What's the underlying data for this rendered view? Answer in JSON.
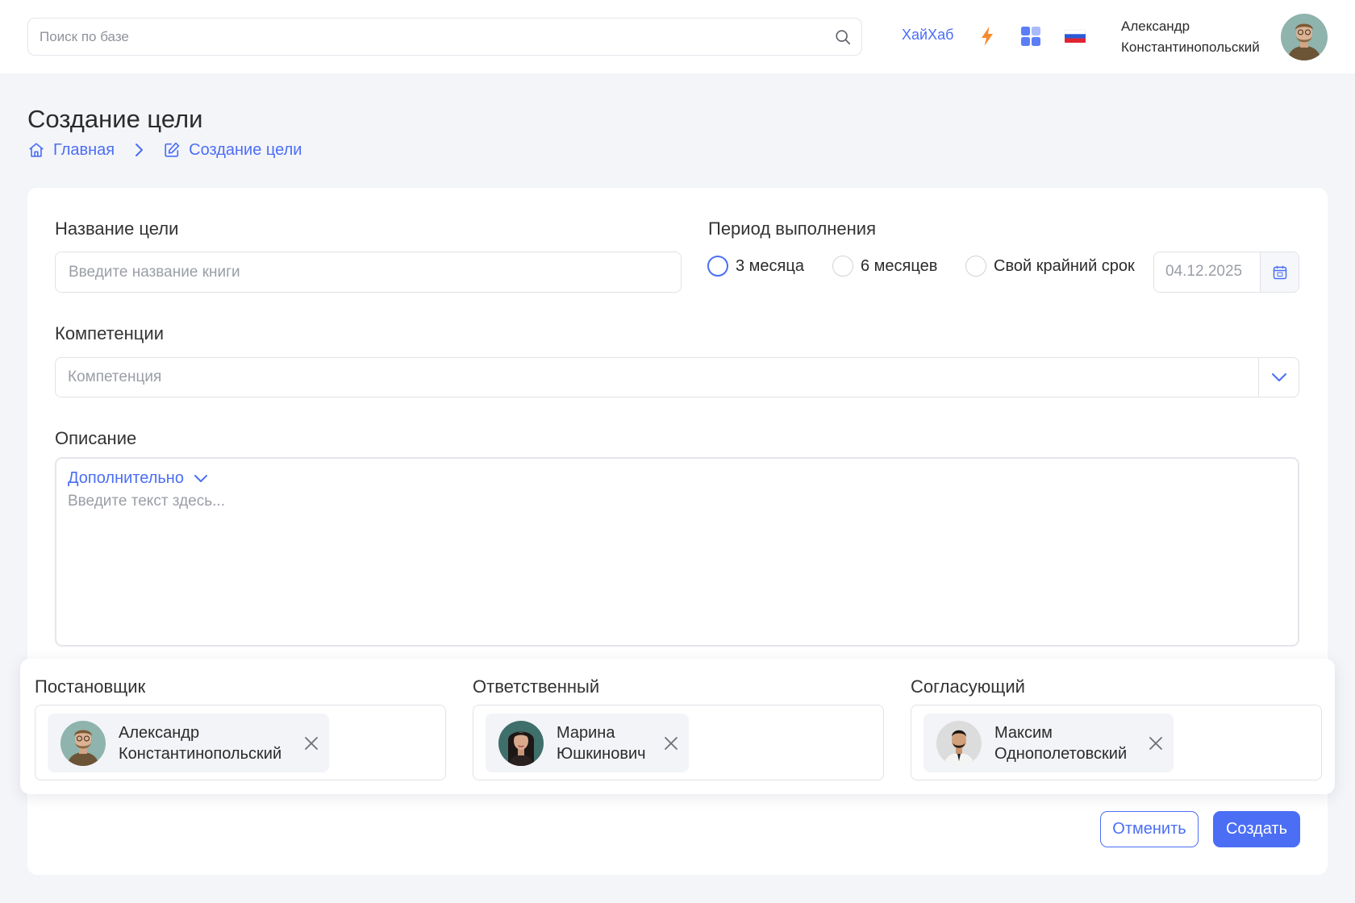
{
  "header": {
    "search_placeholder": "Поиск по базе",
    "hub_link": "ХайХаб",
    "user": {
      "first_name": "Александр",
      "last_name": "Константинопольский"
    },
    "icons": [
      "lightning-icon",
      "apps-grid-icon",
      "russian-flag-icon"
    ]
  },
  "page": {
    "title": "Создание цели",
    "breadcrumb": [
      {
        "label": "Главная",
        "icon": "home-icon"
      },
      {
        "label": "Создание цели",
        "icon": "edit-icon"
      }
    ]
  },
  "form": {
    "goal_name": {
      "label": "Название цели",
      "placeholder": "Введите название книги",
      "value": ""
    },
    "period": {
      "label": "Период выполнения",
      "options": [
        "3 месяца",
        "6 месяцев",
        "Свой крайний срок"
      ],
      "selected": "3 месяца",
      "date": "04.12.2025"
    },
    "competencies": {
      "label": "Компетенции",
      "placeholder": "Компетенция"
    },
    "description": {
      "label": "Описание",
      "toggle": "Дополнительно",
      "placeholder": "Введите текст здесь..."
    }
  },
  "people": {
    "assigner": {
      "label": "Постановщик",
      "first": "Александр",
      "last": "Константинопольский"
    },
    "responsible": {
      "label": "Ответственный",
      "first": "Марина",
      "last": "Юшкинович"
    },
    "approver": {
      "label": "Согласующий",
      "first": "Максим",
      "last": "Однополетовский"
    }
  },
  "actions": {
    "cancel": "Отменить",
    "create": "Создать"
  },
  "colors": {
    "accent": "#4b6ef5",
    "background": "#f4f5f9",
    "lightning": "#f58a2d"
  }
}
